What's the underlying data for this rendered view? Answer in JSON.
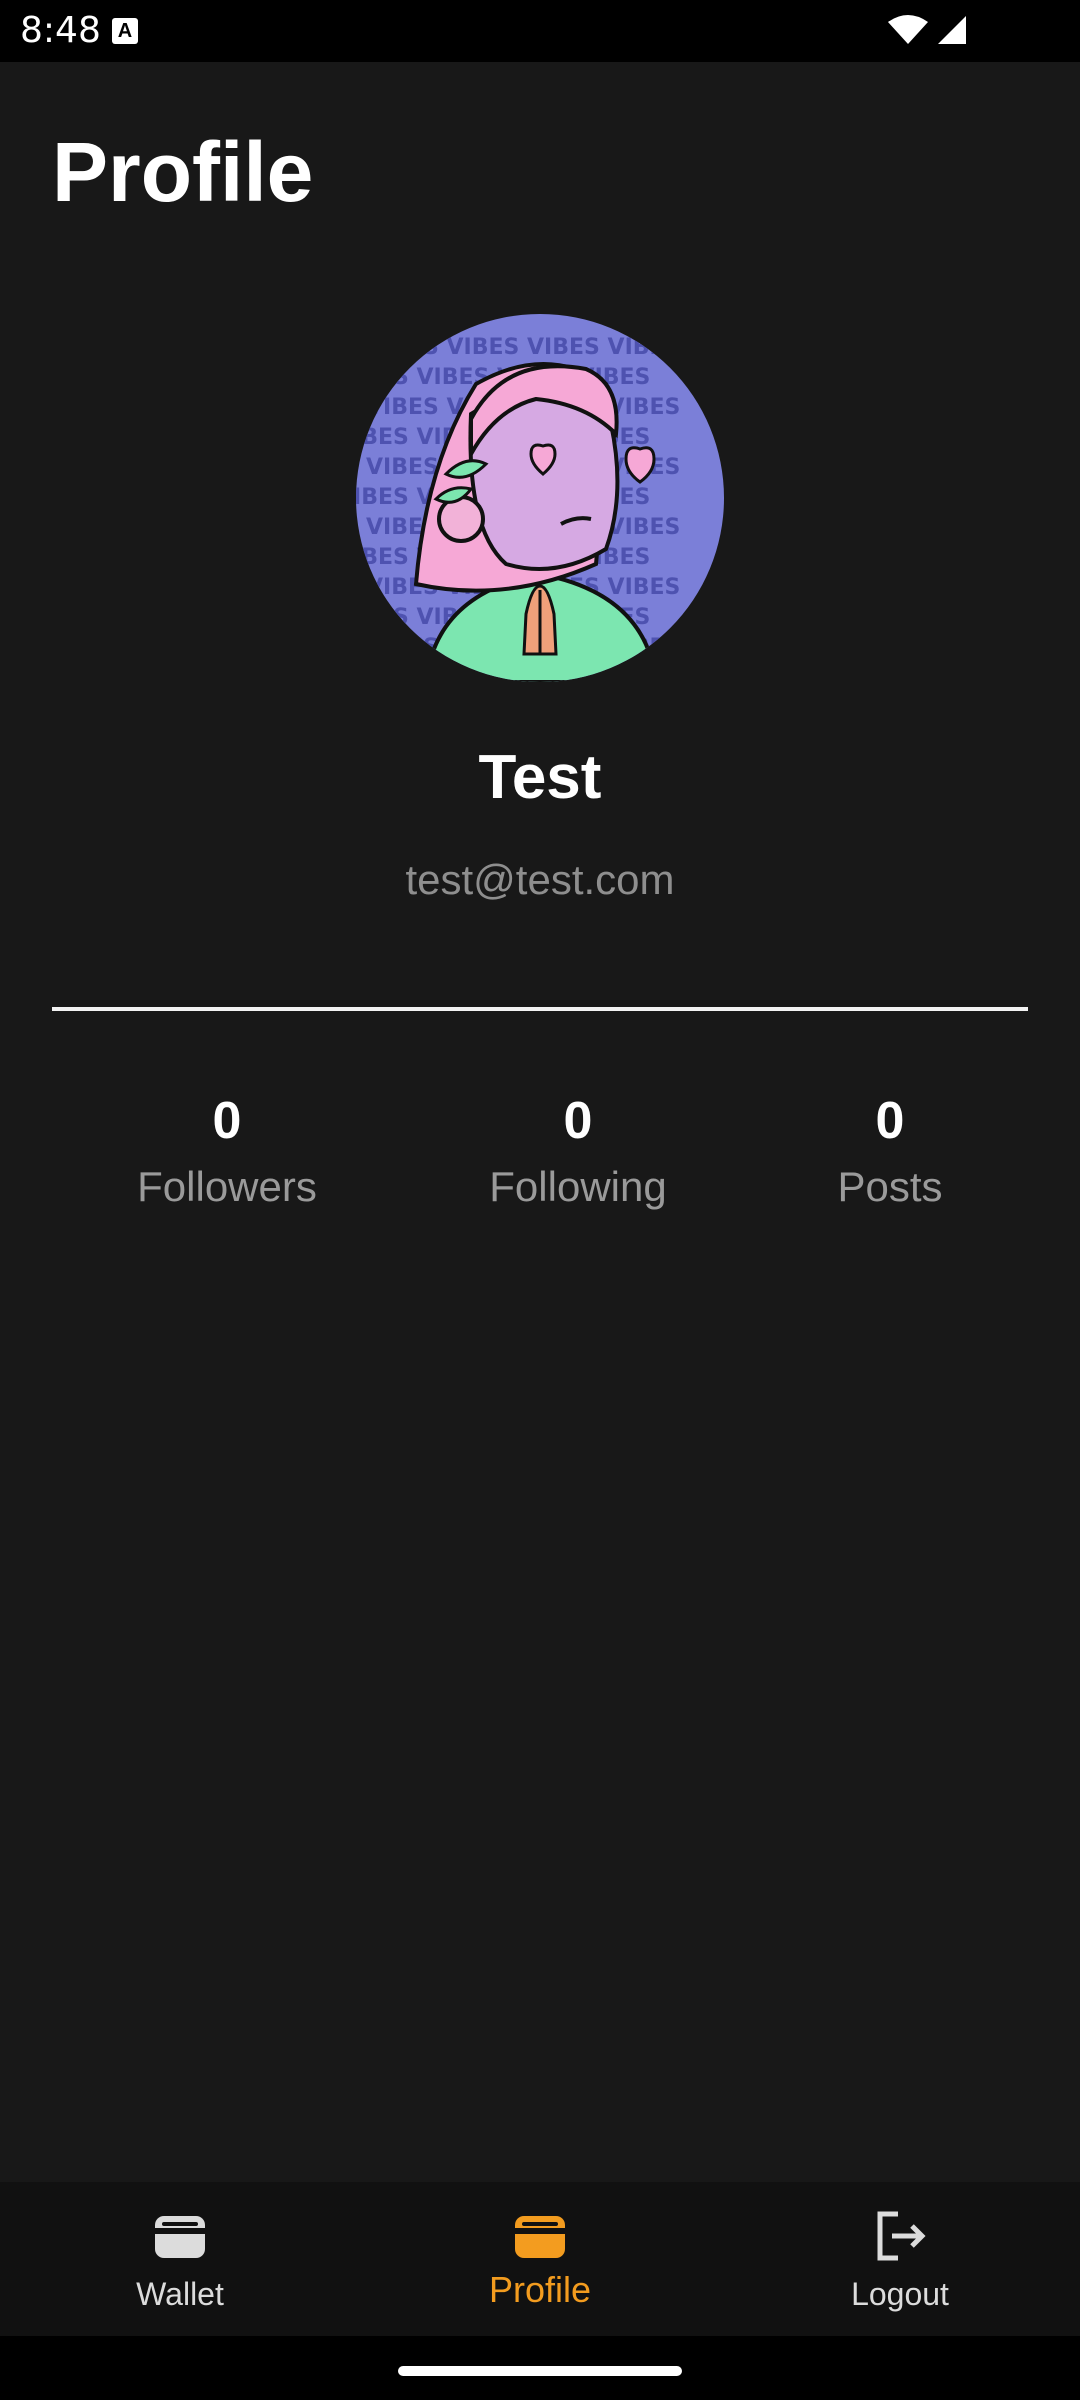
{
  "status_bar": {
    "time": "8:48",
    "notification_icon": "a-letter-icon",
    "wifi_icon": "wifi-icon",
    "signal_icon": "signal-icon"
  },
  "header": {
    "title": "Profile"
  },
  "profile": {
    "avatar_icon": "cartoon-avatar",
    "name": "Test",
    "email": "test@test.com"
  },
  "stats": [
    {
      "value": "0",
      "label": "Followers"
    },
    {
      "value": "0",
      "label": "Following"
    },
    {
      "value": "0",
      "label": "Posts"
    }
  ],
  "bottom_nav": {
    "items": [
      {
        "label": "Wallet",
        "icon": "wallet-icon",
        "active": false
      },
      {
        "label": "Profile",
        "icon": "wallet-icon",
        "active": true
      },
      {
        "label": "Logout",
        "icon": "logout-icon",
        "active": false
      }
    ]
  },
  "colors": {
    "background": "#181818",
    "accent": "#f39c1f",
    "avatar_background": "#7b7fd8"
  }
}
